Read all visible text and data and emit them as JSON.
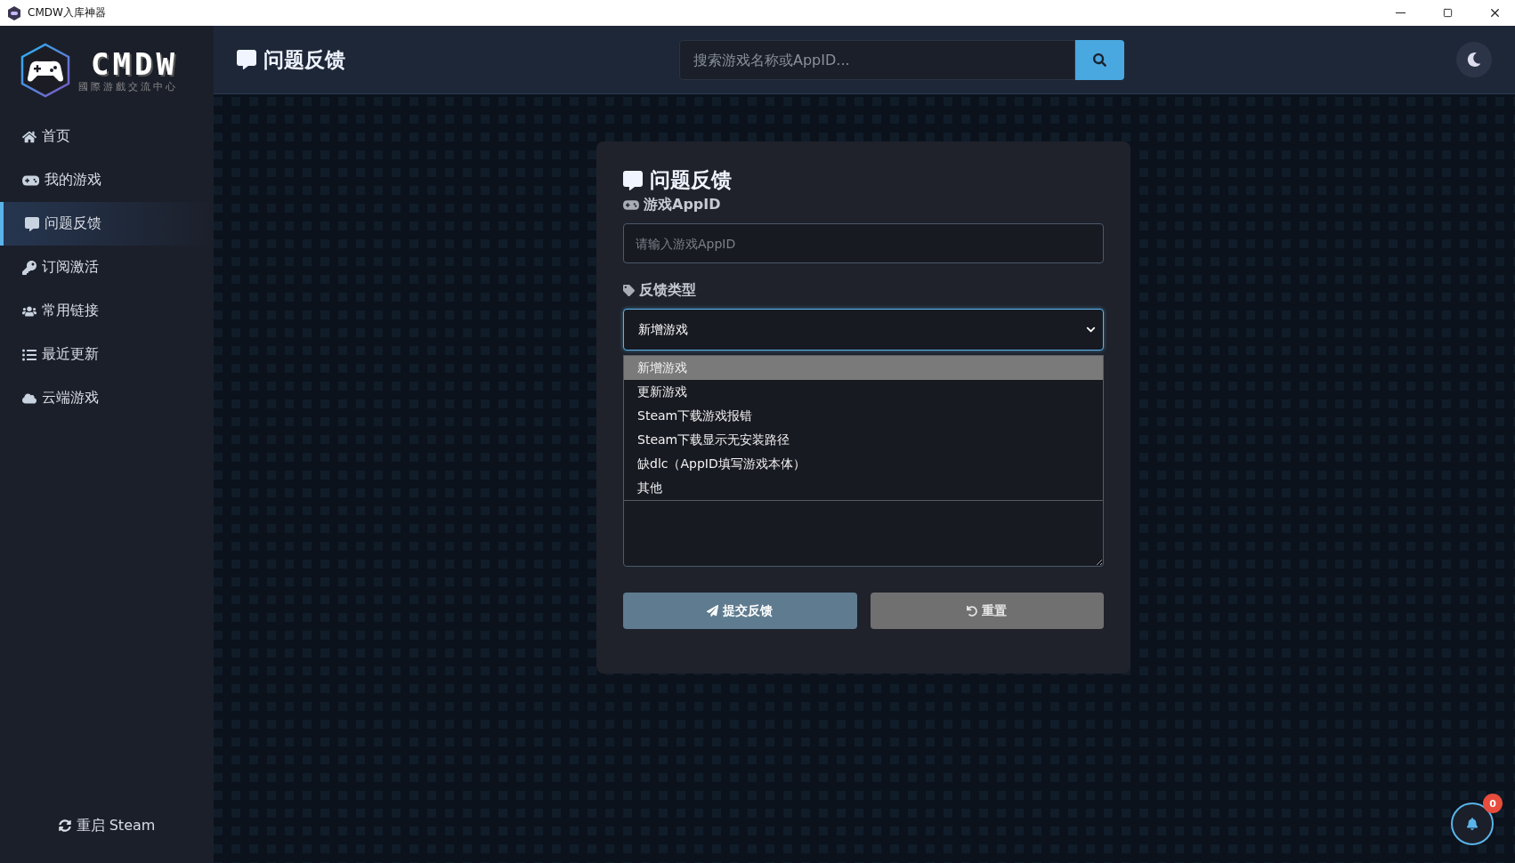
{
  "window": {
    "title": "CMDW入库神器"
  },
  "logo": {
    "name": "CMDW",
    "tagline": "國際游戲交流中心"
  },
  "sidebar": {
    "items": [
      {
        "label": "首页",
        "selected": false
      },
      {
        "label": "我的游戏",
        "selected": false
      },
      {
        "label": "问题反馈",
        "selected": true
      },
      {
        "label": "订阅激活",
        "selected": false
      },
      {
        "label": "常用链接",
        "selected": false
      },
      {
        "label": "最近更新",
        "selected": false
      },
      {
        "label": "云端游戏",
        "selected": false
      }
    ],
    "footer": "重启 Steam"
  },
  "header": {
    "title": "问题反馈",
    "search": {
      "placeholder": "搜索游戏名称或AppID..."
    }
  },
  "form": {
    "title": "问题反馈",
    "appid": {
      "label": "游戏AppID",
      "placeholder": "请输入游戏AppID"
    },
    "type": {
      "label": "反馈类型",
      "value": "新增游戏",
      "expanded": true,
      "options": [
        {
          "label": "新增游戏",
          "selected": true
        },
        {
          "label": "更新游戏",
          "selected": false
        },
        {
          "label": "Steam下载游戏报错",
          "selected": false
        },
        {
          "label": "Steam下载显示无安装路径",
          "selected": false
        },
        {
          "label": "缺dlc（AppID填写游戏本体）",
          "selected": false
        },
        {
          "label": "其他",
          "selected": false
        }
      ]
    },
    "buttons": [
      {
        "label": "提交反馈",
        "kind": "primary"
      },
      {
        "label": "重置",
        "kind": "secondary"
      }
    ]
  },
  "notifications": {
    "count": "0"
  }
}
